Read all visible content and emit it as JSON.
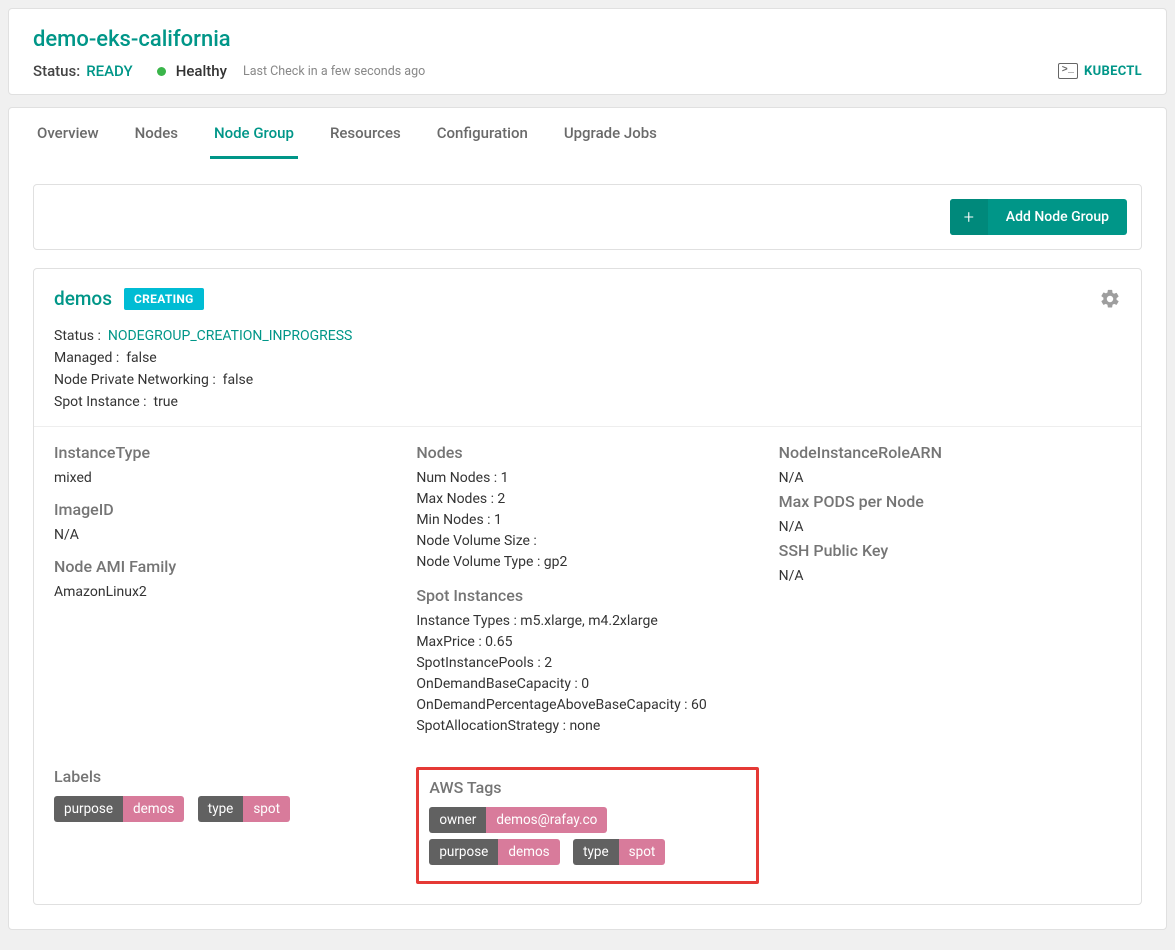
{
  "cluster": {
    "name": "demo-eks-california",
    "status_label": "Status:",
    "status_value": "READY",
    "health_text": "Healthy",
    "last_check": "Last Check in a few seconds ago",
    "kubectl_label": "KUBECTL"
  },
  "tabs": {
    "overview": "Overview",
    "nodes": "Nodes",
    "node_group": "Node Group",
    "resources": "Resources",
    "configuration": "Configuration",
    "upgrade_jobs": "Upgrade Jobs"
  },
  "actions": {
    "add_node_group": "Add Node Group"
  },
  "node_group": {
    "name": "demos",
    "badge": "CREATING",
    "meta": {
      "status_label": "Status :",
      "status_value": "NODEGROUP_CREATION_INPROGRESS",
      "managed_label": "Managed :",
      "managed_value": "false",
      "npn_label": "Node Private Networking :",
      "npn_value": "false",
      "spot_label": "Spot Instance :",
      "spot_value": "true"
    },
    "col1": {
      "instance_type_h": "InstanceType",
      "instance_type_v": "mixed",
      "image_id_h": "ImageID",
      "image_id_v": "N/A",
      "ami_h": "Node AMI Family",
      "ami_v": "AmazonLinux2"
    },
    "col2": {
      "nodes_h": "Nodes",
      "num_nodes": "Num Nodes :  1",
      "max_nodes": "Max Nodes :  2",
      "min_nodes": "Min Nodes :  1",
      "vol_size": "Node Volume Size :",
      "vol_type": "Node Volume Type :   gp2",
      "spot_h": "Spot Instances",
      "instance_types": "Instance Types :   m5.xlarge, m4.2xlarge",
      "max_price": "MaxPrice :   0.65",
      "pools": "SpotInstancePools :   2",
      "ondemand_base": "OnDemandBaseCapacity :   0",
      "ondemand_pct": "OnDemandPercentageAboveBaseCapacity :   60",
      "strategy": "SpotAllocationStrategy :   none"
    },
    "col3": {
      "role_h": "NodeInstanceRoleARN",
      "role_v": "N/A",
      "maxpods_h": "Max PODS per Node",
      "maxpods_v": "N/A",
      "ssh_h": "SSH Public Key",
      "ssh_v": "N/A"
    },
    "labels_h": "Labels",
    "labels": [
      {
        "k": "purpose",
        "v": "demos"
      },
      {
        "k": "type",
        "v": "spot"
      }
    ],
    "aws_tags_h": "AWS Tags",
    "aws_tags": [
      {
        "k": "owner",
        "v": "demos@rafay.co"
      },
      {
        "k": "purpose",
        "v": "demos"
      },
      {
        "k": "type",
        "v": "spot"
      }
    ]
  }
}
